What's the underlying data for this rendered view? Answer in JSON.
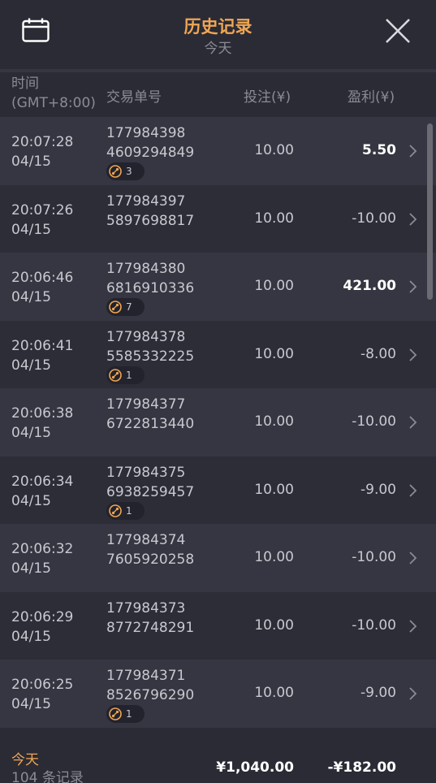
{
  "header": {
    "title": "历史记录",
    "subtitle": "今天",
    "calendar_icon": "calendar-icon",
    "close_icon": "close-icon"
  },
  "columns": {
    "time": "时间",
    "timezone": "(GMT+8:00)",
    "order": "交易单号",
    "bet": "投注(¥)",
    "profit": "盈利(¥)"
  },
  "rows": [
    {
      "time": "20:07:28",
      "date": "04/15",
      "order_a": "177984398",
      "order_b": "4609294849",
      "badge": "3",
      "bet": "10.00",
      "profit": "5.50",
      "positive": true
    },
    {
      "time": "20:07:26",
      "date": "04/15",
      "order_a": "177984397",
      "order_b": "5897698817",
      "badge": "",
      "bet": "10.00",
      "profit": "-10.00",
      "positive": false
    },
    {
      "time": "20:06:46",
      "date": "04/15",
      "order_a": "177984380",
      "order_b": "6816910336",
      "badge": "7",
      "bet": "10.00",
      "profit": "421.00",
      "positive": true
    },
    {
      "time": "20:06:41",
      "date": "04/15",
      "order_a": "177984378",
      "order_b": "5585332225",
      "badge": "1",
      "bet": "10.00",
      "profit": "-8.00",
      "positive": false
    },
    {
      "time": "20:06:38",
      "date": "04/15",
      "order_a": "177984377",
      "order_b": "6722813440",
      "badge": "",
      "bet": "10.00",
      "profit": "-10.00",
      "positive": false
    },
    {
      "time": "20:06:34",
      "date": "04/15",
      "order_a": "177984375",
      "order_b": "6938259457",
      "badge": "1",
      "bet": "10.00",
      "profit": "-9.00",
      "positive": false
    },
    {
      "time": "20:06:32",
      "date": "04/15",
      "order_a": "177984374",
      "order_b": "7605920258",
      "badge": "",
      "bet": "10.00",
      "profit": "-10.00",
      "positive": false
    },
    {
      "time": "20:06:29",
      "date": "04/15",
      "order_a": "177984373",
      "order_b": "8772748291",
      "badge": "",
      "bet": "10.00",
      "profit": "-10.00",
      "positive": false
    },
    {
      "time": "20:06:25",
      "date": "04/15",
      "order_a": "177984371",
      "order_b": "8526796290",
      "badge": "1",
      "bet": "10.00",
      "profit": "-9.00",
      "positive": false
    }
  ],
  "footer": {
    "label": "今天",
    "count": "104 条记录",
    "total_bet": "¥1,040.00",
    "total_profit": "-¥182.00"
  },
  "colors": {
    "accent": "#f0a654",
    "background": "#2a2b35",
    "row_odd": "#353641",
    "row_even": "#2c2d37"
  }
}
